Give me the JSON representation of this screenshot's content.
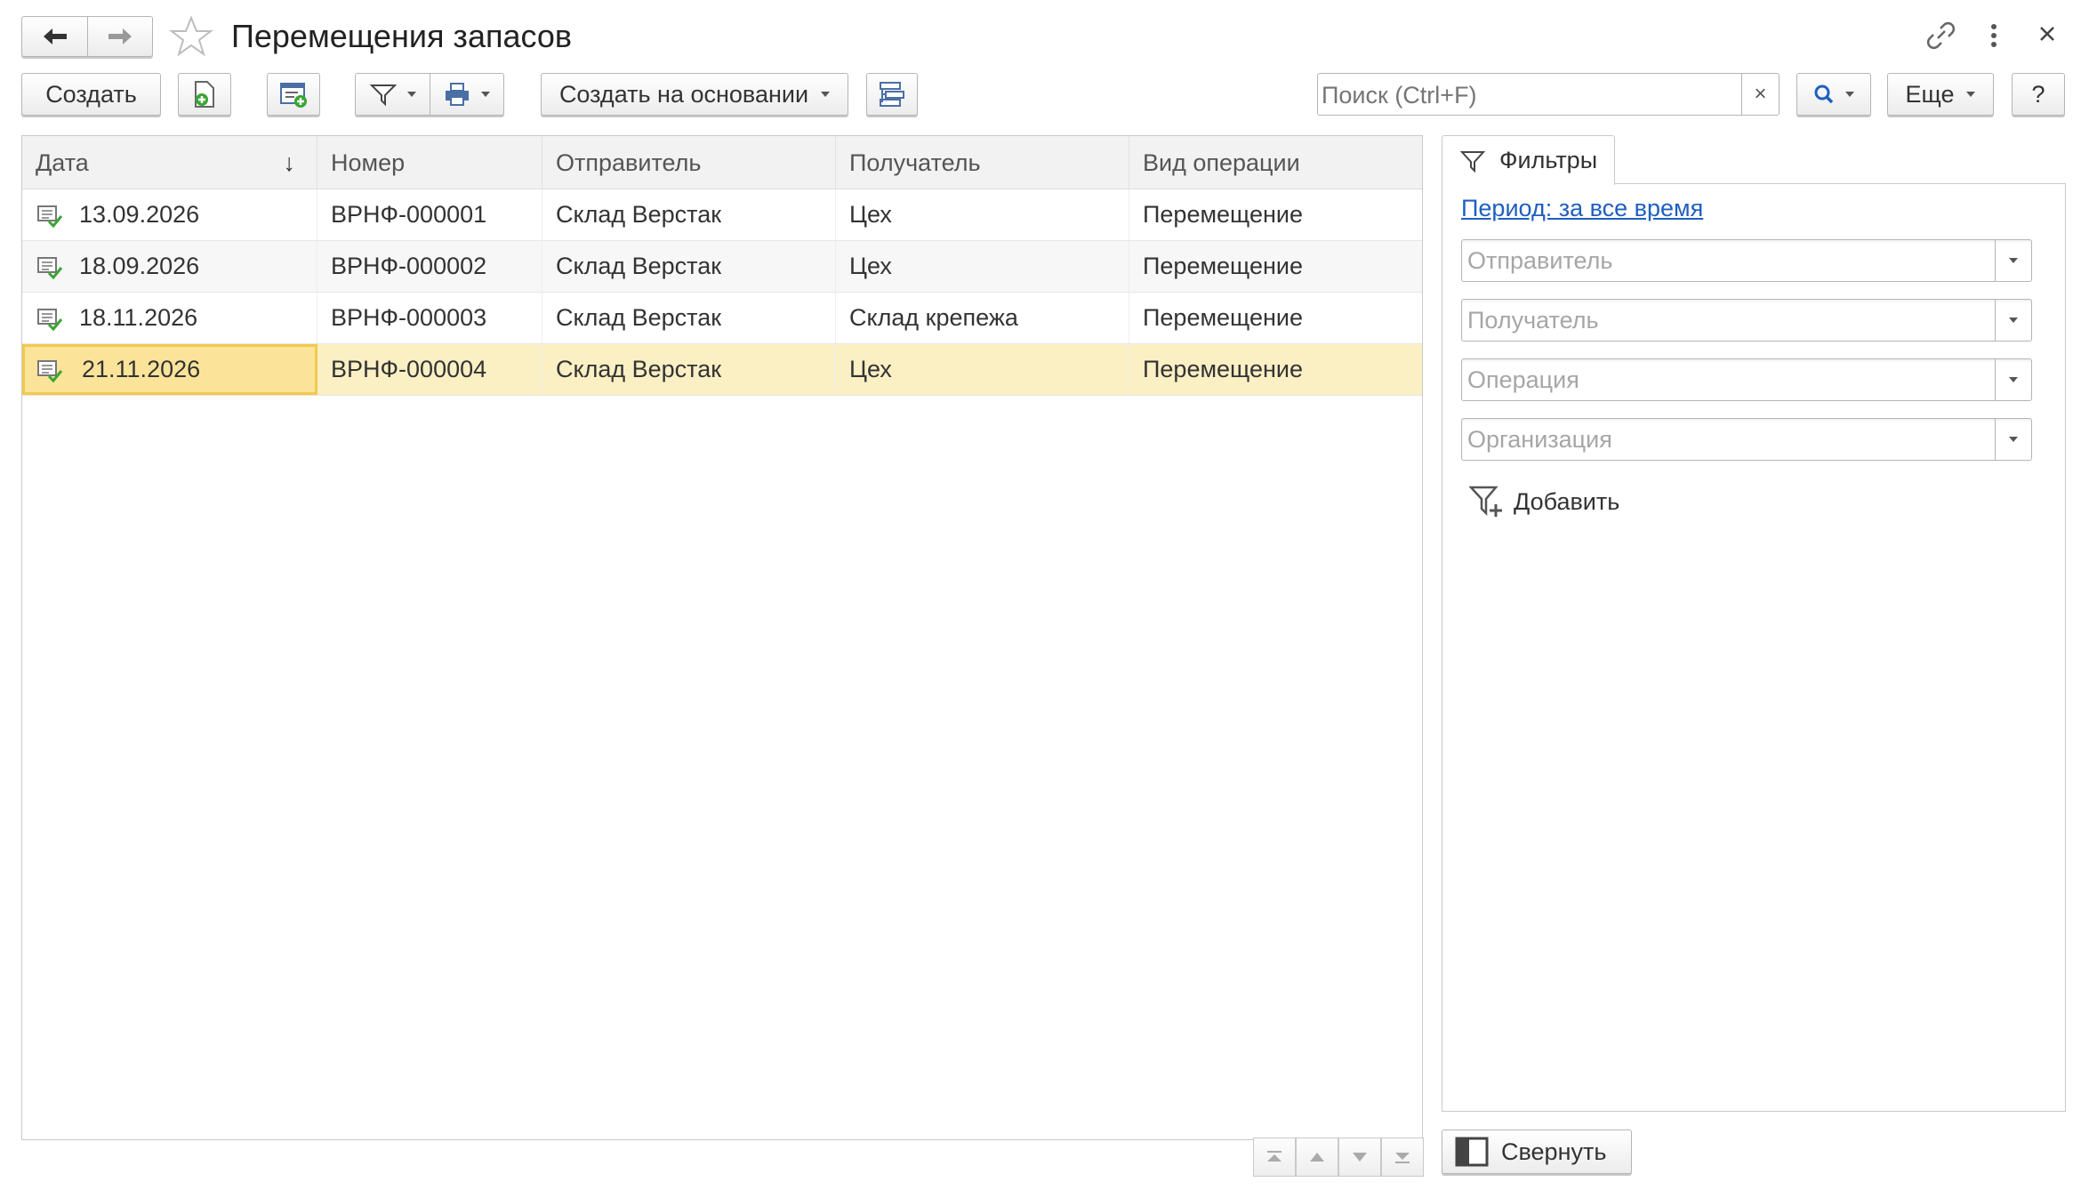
{
  "window": {
    "title": "Перемещения запасов"
  },
  "toolbar": {
    "create_label": "Создать",
    "create_based_label": "Создать на основании",
    "more_label": "Еще",
    "help_label": "?",
    "search_placeholder": "Поиск (Ctrl+F)",
    "search_clear": "×"
  },
  "table": {
    "columns": [
      "Дата",
      "Номер",
      "Отправитель",
      "Получатель",
      "Вид операции"
    ],
    "sort_indicator": "↓",
    "rows": [
      {
        "date": "13.09.2026",
        "number": "ВРНФ-000001",
        "sender": "Склад Верстак",
        "receiver": "Цех",
        "operation": "Перемещение"
      },
      {
        "date": "18.09.2026",
        "number": "ВРНФ-000002",
        "sender": "Склад Верстак",
        "receiver": "Цех",
        "operation": "Перемещение"
      },
      {
        "date": "18.11.2026",
        "number": "ВРНФ-000003",
        "sender": "Склад Верстак",
        "receiver": "Склад крепежа",
        "operation": "Перемещение"
      },
      {
        "date": "21.11.2026",
        "number": "ВРНФ-000004",
        "sender": "Склад Верстак",
        "receiver": "Цех",
        "operation": "Перемещение"
      }
    ],
    "selected_row": 3
  },
  "filters": {
    "tab_label": "Фильтры",
    "period_link": "Период: за все время",
    "fields": [
      {
        "placeholder": "Отправитель"
      },
      {
        "placeholder": "Получатель"
      },
      {
        "placeholder": "Операция"
      },
      {
        "placeholder": "Организация"
      }
    ],
    "add_label": "Добавить",
    "collapse_label": "Свернуть"
  },
  "colors": {
    "selected_row_bg": "#fbefc4",
    "selected_cell_border": "#f2c94c",
    "link": "#1f5fbf",
    "accent_green": "#3aa535"
  }
}
